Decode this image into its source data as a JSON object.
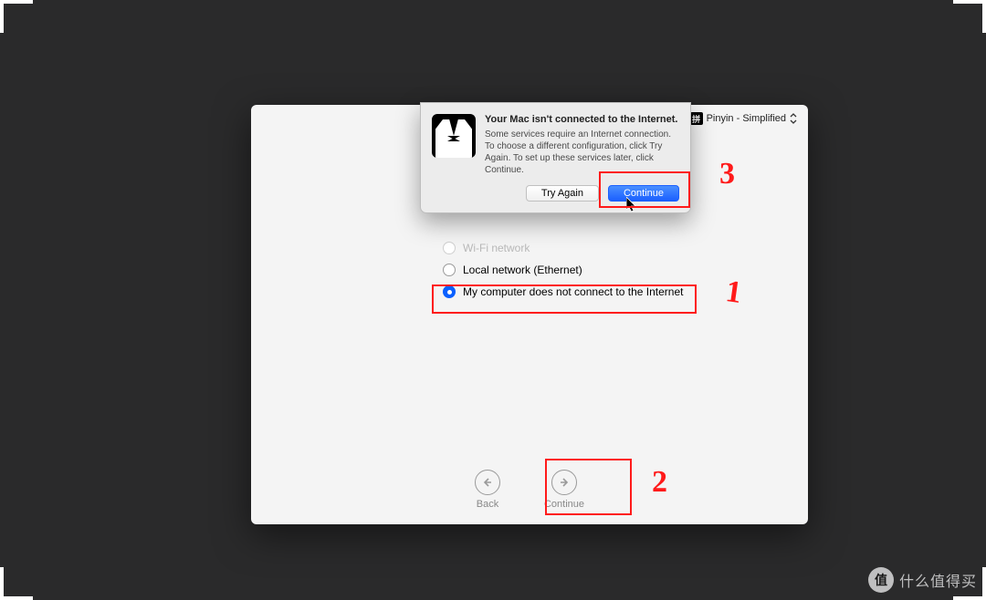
{
  "ime": {
    "label": "Pinyin - Simplified",
    "icon_char": "拼"
  },
  "options": [
    {
      "label": "Wi-Fi network",
      "selected": false,
      "dim": true
    },
    {
      "label": "Local network (Ethernet)",
      "selected": false,
      "dim": false
    },
    {
      "label": "My computer does not connect to the Internet",
      "selected": true,
      "dim": false
    }
  ],
  "nav": {
    "back": "Back",
    "continue": "Continue"
  },
  "dialog": {
    "title": "Your Mac isn't connected to the Internet.",
    "body": "Some services require an Internet connection. To choose a different configuration, click Try Again. To set up these services later, click Continue.",
    "try_again": "Try Again",
    "continue": "Continue"
  },
  "annotations": {
    "one": "1",
    "two": "2",
    "three": "3"
  },
  "watermark": {
    "icon_char": "值",
    "text": "什么值得买"
  }
}
